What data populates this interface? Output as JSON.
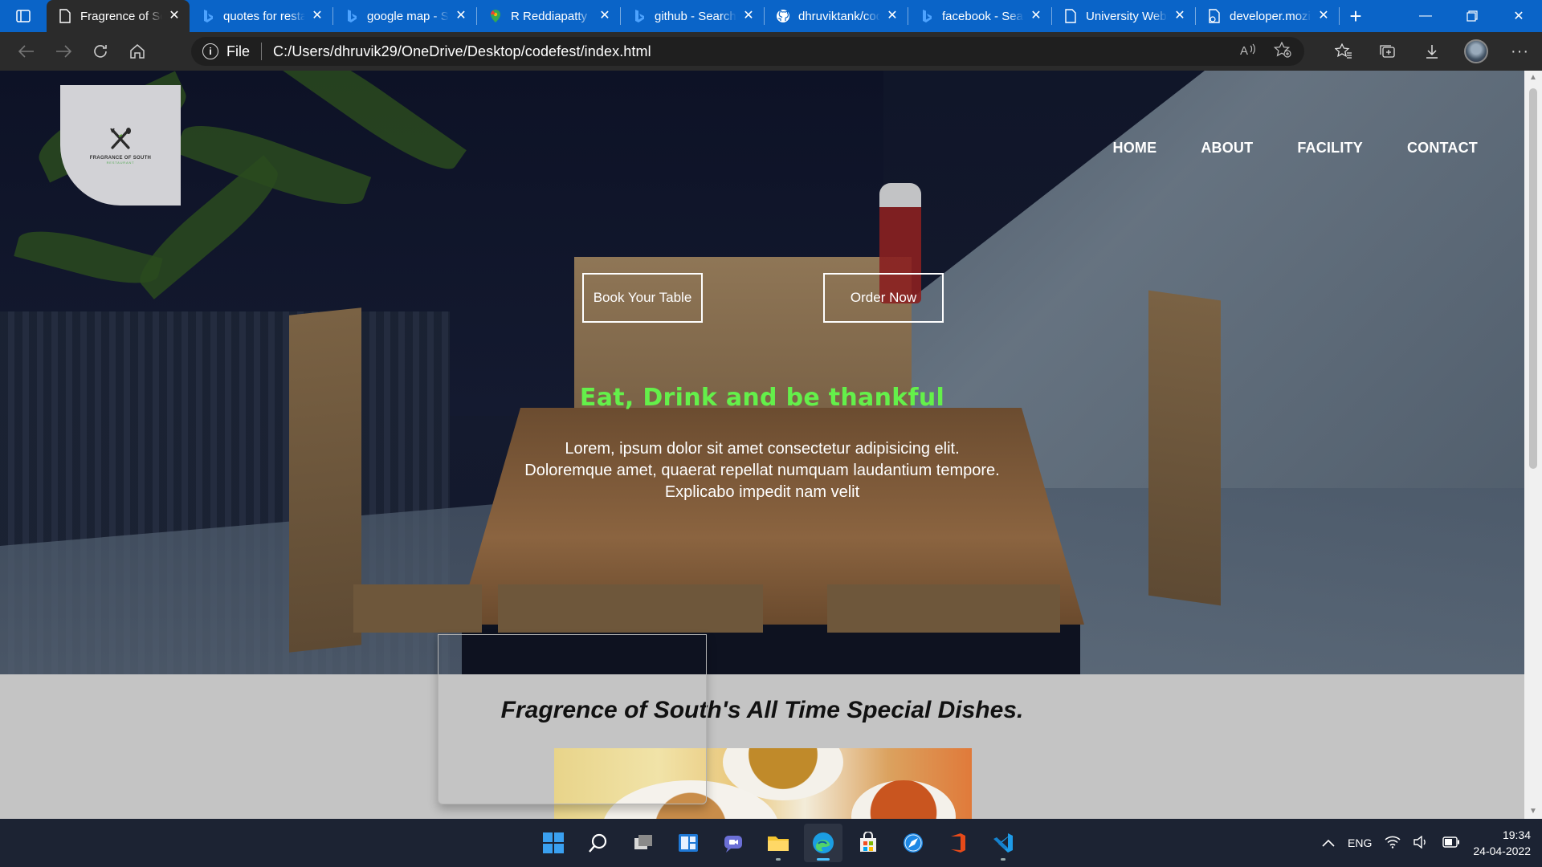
{
  "browser": {
    "tabs": [
      {
        "title": "Fragrence of South",
        "favicon": "page-icon",
        "active": true
      },
      {
        "title": "quotes for restaurant",
        "favicon": "bing-icon",
        "active": false
      },
      {
        "title": "google map - Search",
        "favicon": "bing-icon",
        "active": false
      },
      {
        "title": "R Reddiapatty",
        "favicon": "maps-icon",
        "active": false
      },
      {
        "title": "github - Search",
        "favicon": "bing-icon",
        "active": false
      },
      {
        "title": "dhruviktank/codefest",
        "favicon": "github-icon",
        "active": false
      },
      {
        "title": "facebook - Search",
        "favicon": "bing-icon",
        "active": false
      },
      {
        "title": "University Website",
        "favicon": "page-icon",
        "active": false
      },
      {
        "title": "developer.mozilla",
        "favicon": "mdn-icon",
        "active": false
      }
    ],
    "address": {
      "scheme_label": "File",
      "url": "C:/Users/dhruvik29/OneDrive/Desktop/codefest/index.html"
    }
  },
  "site": {
    "logo": {
      "name": "FRAGRANCE OF SOUTH",
      "sub": "RESTAURANT"
    },
    "nav": [
      "HOME",
      "ABOUT",
      "FACILITY",
      "CONTACT"
    ],
    "cta": {
      "book": "Book Your Table",
      "order": "Order Now"
    },
    "tagline": "Eat, Drink and be thankful",
    "description": [
      "Lorem, ipsum dolor sit amet consectetur adipisicing elit.",
      "Doloremque amet, quaerat repellat numquam laudantium tempore.",
      "Explicabo impedit nam velit"
    ],
    "specials_title": "Fragrence of South's All Time Special Dishes."
  },
  "taskbar": {
    "language": "ENG",
    "time": "19:34",
    "date": "24-04-2022"
  },
  "colors": {
    "tabbar": "#0a64c8",
    "tagline": "#64f04a",
    "section_bg": "#c4c4c4"
  }
}
